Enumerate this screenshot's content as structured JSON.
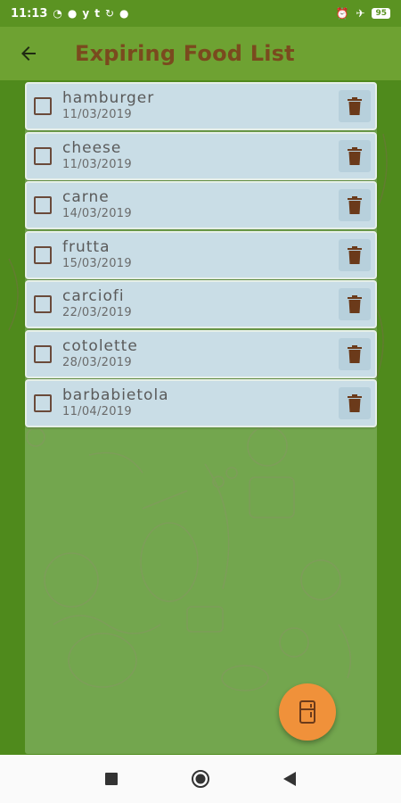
{
  "status_bar": {
    "time": "11:13",
    "battery": "95"
  },
  "app_bar": {
    "title": "Expiring Food List"
  },
  "food_items": [
    {
      "name": "hamburger",
      "date": "11/03/2019"
    },
    {
      "name": "cheese",
      "date": "11/03/2019"
    },
    {
      "name": "carne",
      "date": "14/03/2019"
    },
    {
      "name": "frutta",
      "date": "15/03/2019"
    },
    {
      "name": "carciofi",
      "date": "22/03/2019"
    },
    {
      "name": "cotolette",
      "date": "28/03/2019"
    },
    {
      "name": "barbabietola",
      "date": "11/04/2019"
    }
  ],
  "icons": {
    "back": "arrow-back-icon",
    "delete": "trash-icon",
    "fab": "fridge-icon",
    "nav_recents": "square-icon",
    "nav_home": "circle-icon",
    "nav_back": "triangle-icon"
  },
  "colors": {
    "status_bar": "#5b9322",
    "app_bar": "#6ea232",
    "title": "#7a4a1e",
    "item_bg": "#c9dde6",
    "trash": "#6b3a1a",
    "fab": "#f0913a"
  }
}
